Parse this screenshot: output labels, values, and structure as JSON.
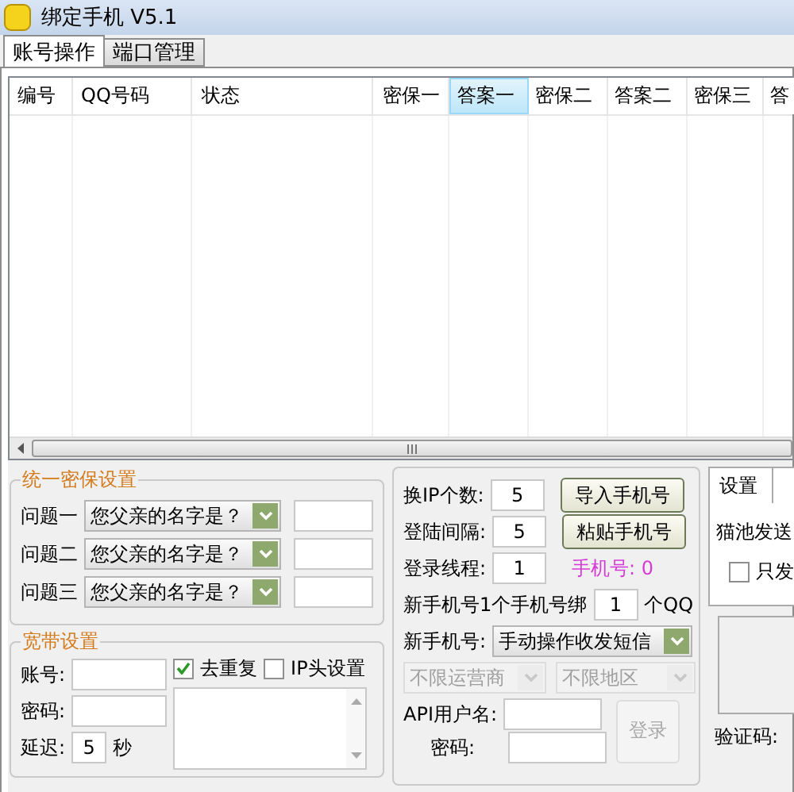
{
  "window": {
    "title": "绑定手机 V5.1"
  },
  "tabs": [
    {
      "label": "账号操作",
      "selected": true
    },
    {
      "label": "端口管理",
      "selected": false
    }
  ],
  "table": {
    "columns": [
      {
        "label": "编号",
        "selected": false
      },
      {
        "label": "QQ号码",
        "selected": false
      },
      {
        "label": "状态",
        "selected": false
      },
      {
        "label": "密保一",
        "selected": false
      },
      {
        "label": "答案一",
        "selected": true
      },
      {
        "label": "密保二",
        "selected": false
      },
      {
        "label": "答案二",
        "selected": false
      },
      {
        "label": "密保三",
        "selected": false
      },
      {
        "label": "答",
        "selected": false
      }
    ]
  },
  "security": {
    "title": "统一密保设置",
    "rows": [
      {
        "label": "问题一",
        "question": "您父亲的名字是？"
      },
      {
        "label": "问题二",
        "question": "您父亲的名字是？"
      },
      {
        "label": "问题三",
        "question": "您父亲的名字是？"
      }
    ]
  },
  "broadband": {
    "title": "宽带设置",
    "account_label": "账号:",
    "password_label": "密码:",
    "delay_label": "延迟:",
    "delay_value": "5",
    "delay_unit": "秒",
    "options": [
      {
        "label": "去重复",
        "checked": true
      },
      {
        "label": "IP头设置",
        "checked": false
      }
    ]
  },
  "phone": {
    "ip_count_label": "换IP个数:",
    "ip_count": "5",
    "interval_label": "登陆间隔:",
    "interval": "5",
    "threads_label": "登录线程:",
    "threads": "1",
    "import_button": "导入手机号",
    "paste_button": "粘贴手机号",
    "phone_count": "手机号: 0",
    "bind_label": "新手机号1个手机号绑",
    "bind_value": "1",
    "bind_unit": "个QQ",
    "mode_label": "新手机号:",
    "mode": {
      "value": "手动操作收发短信",
      "disabled": false
    },
    "carrier": {
      "value": "不限运营商",
      "disabled": true
    },
    "region": {
      "value": "不限地区",
      "disabled": true
    },
    "api_user_label": "API用户名:",
    "api_password_label": "密码:",
    "login_button": {
      "label": "登录",
      "disabled": true
    }
  },
  "side": {
    "tab": "设置",
    "send_label": "猫池发送",
    "only_send": {
      "label": "只发",
      "checked": false
    },
    "captcha_label": "验证码:"
  }
}
